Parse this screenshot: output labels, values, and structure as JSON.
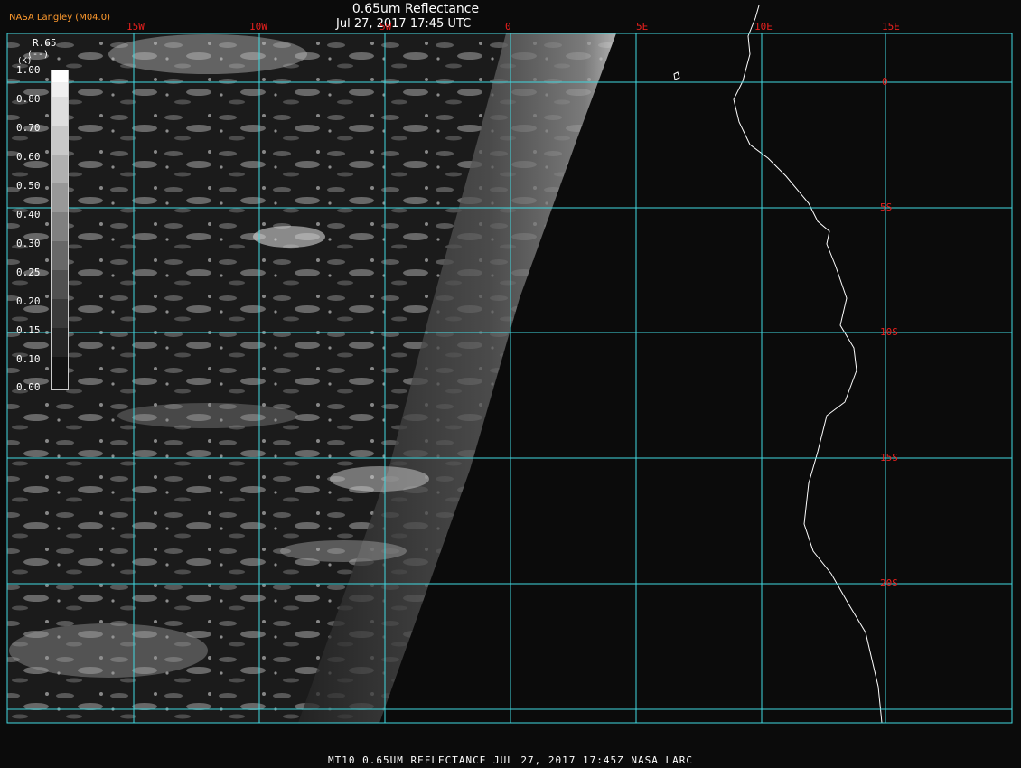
{
  "header": {
    "credit": "NASA Langley (M04.0)",
    "title": "0.65um Reflectance",
    "datetime": "Jul 27, 2017 17:45 UTC"
  },
  "footer": {
    "caption": "MT10  0.65UM REFLECTANCE   JUL 27, 2017 17:45Z   NASA LARC"
  },
  "legend": {
    "title": "R.65",
    "unit": "(--)",
    "unit_prefix": "(K)",
    "ticks": [
      "1.00",
      "0.80",
      "0.70",
      "0.60",
      "0.50",
      "0.40",
      "0.30",
      "0.25",
      "0.20",
      "0.15",
      "0.10",
      "0.00"
    ]
  },
  "grid": {
    "longitudes": [
      "15W",
      "10W",
      "5W",
      "0",
      "5E",
      "10E",
      "15E"
    ],
    "latitudes": [
      "0",
      "5S",
      "10S",
      "15S",
      "20S"
    ],
    "color": "#40d8e0",
    "label_color": "#e8201e"
  },
  "colors": {
    "coast": "#ffffff",
    "space": "#0a0a0a",
    "credit": "#ff9a2e"
  }
}
